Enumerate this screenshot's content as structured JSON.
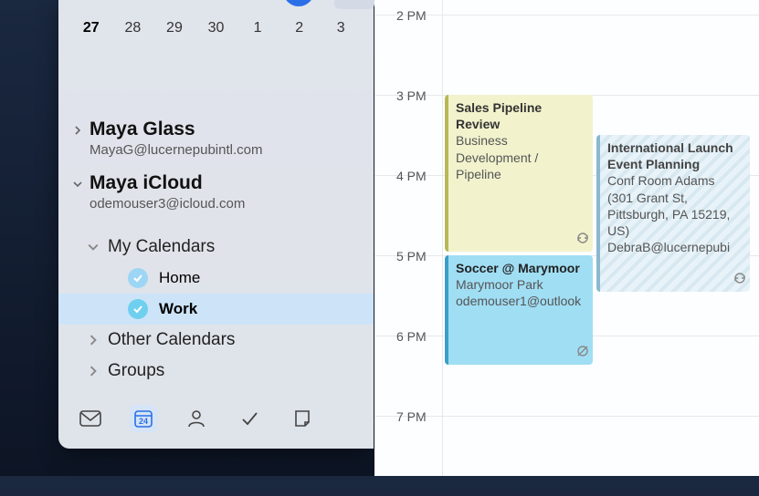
{
  "mini_calendar": {
    "days": [
      "27",
      "28",
      "29",
      "30",
      "1",
      "2",
      "3"
    ]
  },
  "accounts": [
    {
      "name": "Maya Glass",
      "email": "MayaG@lucernepubintl.com",
      "expanded": false
    },
    {
      "name": "Maya iCloud",
      "email": "odemouser3@icloud.com",
      "expanded": true
    }
  ],
  "sections": {
    "my_calendars": "My Calendars",
    "other_calendars": "Other Calendars",
    "groups": "Groups"
  },
  "calendars": [
    {
      "label": "Home",
      "selected": false,
      "checked": true
    },
    {
      "label": "Work",
      "selected": true,
      "checked": true
    }
  ],
  "nav_labels": {
    "mail": "Mail",
    "calendar": "Calendar",
    "people": "People",
    "todo": "To Do",
    "notes": "Notes"
  },
  "calendar_icon_day": "24",
  "timeline": {
    "hours": [
      "2 PM",
      "3 PM",
      "4 PM",
      "5 PM",
      "6 PM",
      "7 PM"
    ]
  },
  "events": [
    {
      "title": "Sales Pipeline Review",
      "sub1": "Business Development / Pipeline",
      "color": "yellow"
    },
    {
      "title": "International Launch Event Planning",
      "sub1": "Conf Room Adams (301 Grant St, Pittsburgh, PA 15219, US)",
      "sub2": "DebraB@lucernepubi",
      "color": "stripe"
    },
    {
      "title": "Soccer @ Marymoor",
      "sub1": "Marymoor Park",
      "sub2": "odemouser1@outlook",
      "color": "blue"
    }
  ]
}
